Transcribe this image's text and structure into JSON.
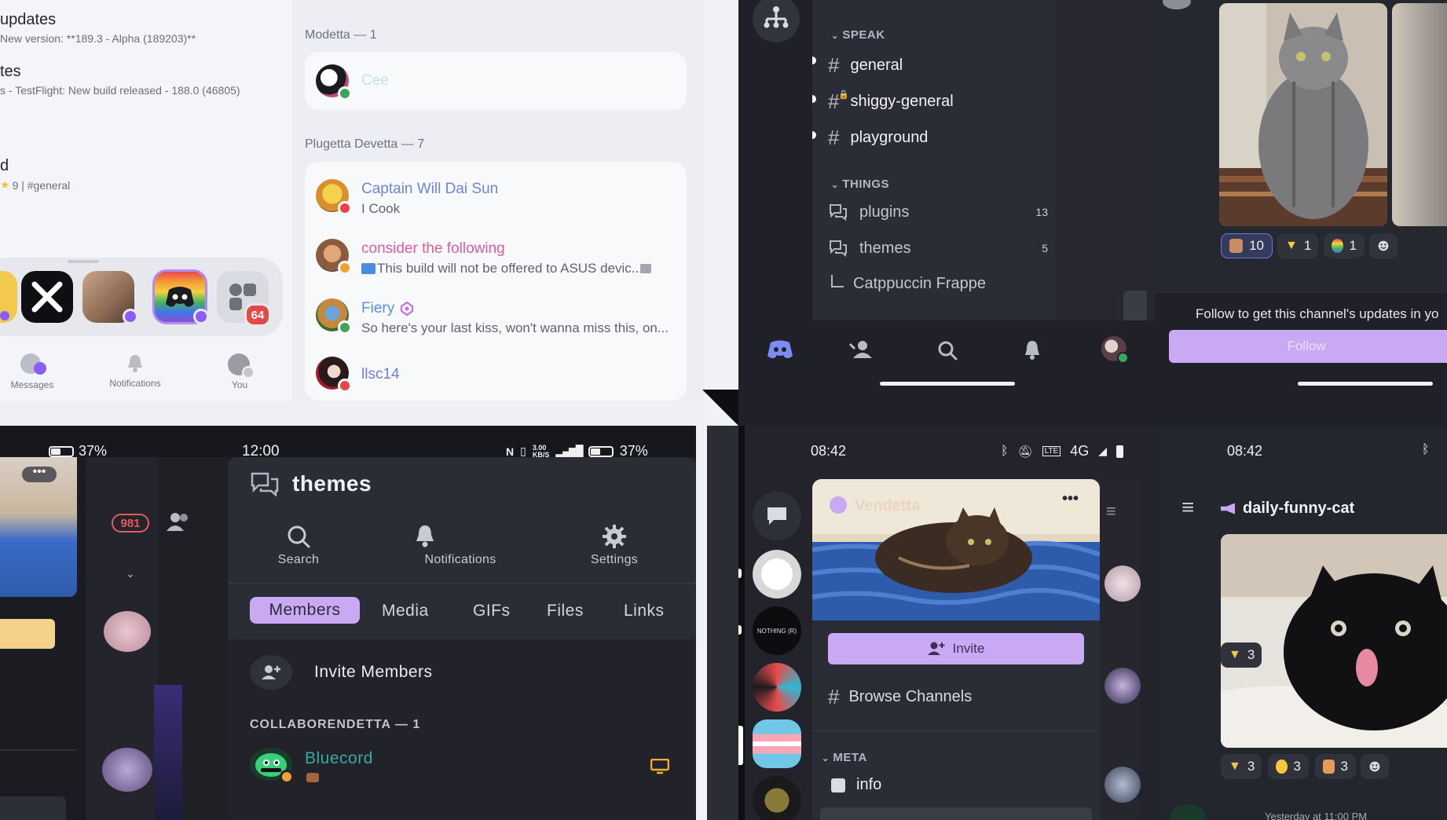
{
  "p1": {
    "updates": [
      {
        "title": "updates",
        "sub": "New version: **189.3 - Alpha (189203)**"
      },
      {
        "title": "tes",
        "sub": "s - TestFlight: New build released - 188.0 (46805)"
      },
      {
        "title": "d",
        "sub": "9 | #general"
      }
    ],
    "modetta_header": "Modetta — 1",
    "modetta_member": "Cee",
    "plugetta_header": "Plugetta Devetta — 7",
    "members": [
      {
        "name": "Captain Will Dai Sun",
        "sub": "I Cook",
        "color": "#6f86d6"
      },
      {
        "name": "consider the following",
        "sub": "This build will not be offered to ASUS devic...",
        "color": "#e05c9c"
      },
      {
        "name": "Fiery",
        "sub": "So here's your last kiss, won't wanna miss this, on...",
        "color": "#5b8fe6"
      },
      {
        "name": "llsc14",
        "sub": "",
        "color": "#6f7ee0"
      }
    ],
    "dock_badge": "64",
    "nav": [
      "Messages",
      "Notifications",
      "You"
    ]
  },
  "p2": {
    "cat_speak": "SPEAK",
    "speak_channels": [
      "general",
      "shiggy-general",
      "playground"
    ],
    "cat_things": "THINGS",
    "things": [
      {
        "name": "plugins",
        "count": "13"
      },
      {
        "name": "themes",
        "count": "5"
      }
    ],
    "thread": "Catppuccin Frappe"
  },
  "p3": {
    "reactions": [
      "10",
      "1",
      "1"
    ],
    "follow_text": "Follow to get this channel's updates in yo",
    "follow_button": "Follow"
  },
  "p4": {
    "status_left": "37%",
    "time": "12:00",
    "net_speed": "3.00",
    "net_unit": "KB/S",
    "status_right": "37%",
    "badge": "981",
    "title": "themes",
    "actions": [
      "Search",
      "Notifications",
      "Settings"
    ],
    "tabs": [
      "Members",
      "Media",
      "GIFs",
      "Files",
      "Links"
    ],
    "invite": "Invite Members",
    "section": "COLLABORENDETTA — 1",
    "member": "Bluecord",
    "colors": {
      "accent": "#c9a9f4",
      "member": "#3aa7a0"
    }
  },
  "p5": {
    "time": "08:42",
    "network": "4G",
    "server_name": "Vendetta",
    "invite": "Invite",
    "browse": "Browse Channels",
    "cat_meta": "META",
    "meta_channel": "info",
    "nothing_label": "NOTHING (R)"
  },
  "p6": {
    "time": "08:42",
    "channel": "daily-funny-cat",
    "reactions": [
      "3",
      "3",
      "3"
    ],
    "footer": "Yesterday at 11:00 PM"
  }
}
